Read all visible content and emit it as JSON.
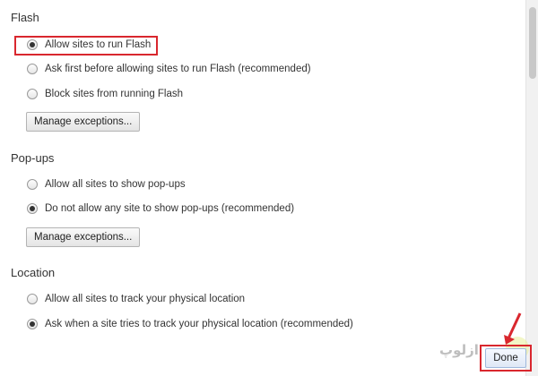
{
  "flash": {
    "title": "Flash",
    "options": [
      {
        "label": "Allow sites to run Flash",
        "checked": true
      },
      {
        "label": "Ask first before allowing sites to run Flash (recommended)",
        "checked": false
      },
      {
        "label": "Block sites from running Flash",
        "checked": false
      }
    ],
    "manage_label": "Manage exceptions..."
  },
  "popups": {
    "title": "Pop-ups",
    "options": [
      {
        "label": "Allow all sites to show pop-ups",
        "checked": false
      },
      {
        "label": "Do not allow any site to show pop-ups (recommended)",
        "checked": true
      }
    ],
    "manage_label": "Manage exceptions..."
  },
  "location": {
    "title": "Location",
    "options": [
      {
        "label": "Allow all sites to track your physical location",
        "checked": false
      },
      {
        "label": "Ask when a site tries to track your physical location (recommended)",
        "checked": true
      }
    ]
  },
  "footer": {
    "done_label": "Done",
    "watermark_text": "ازلوپ"
  },
  "colors": {
    "highlight": "#d9272e"
  }
}
